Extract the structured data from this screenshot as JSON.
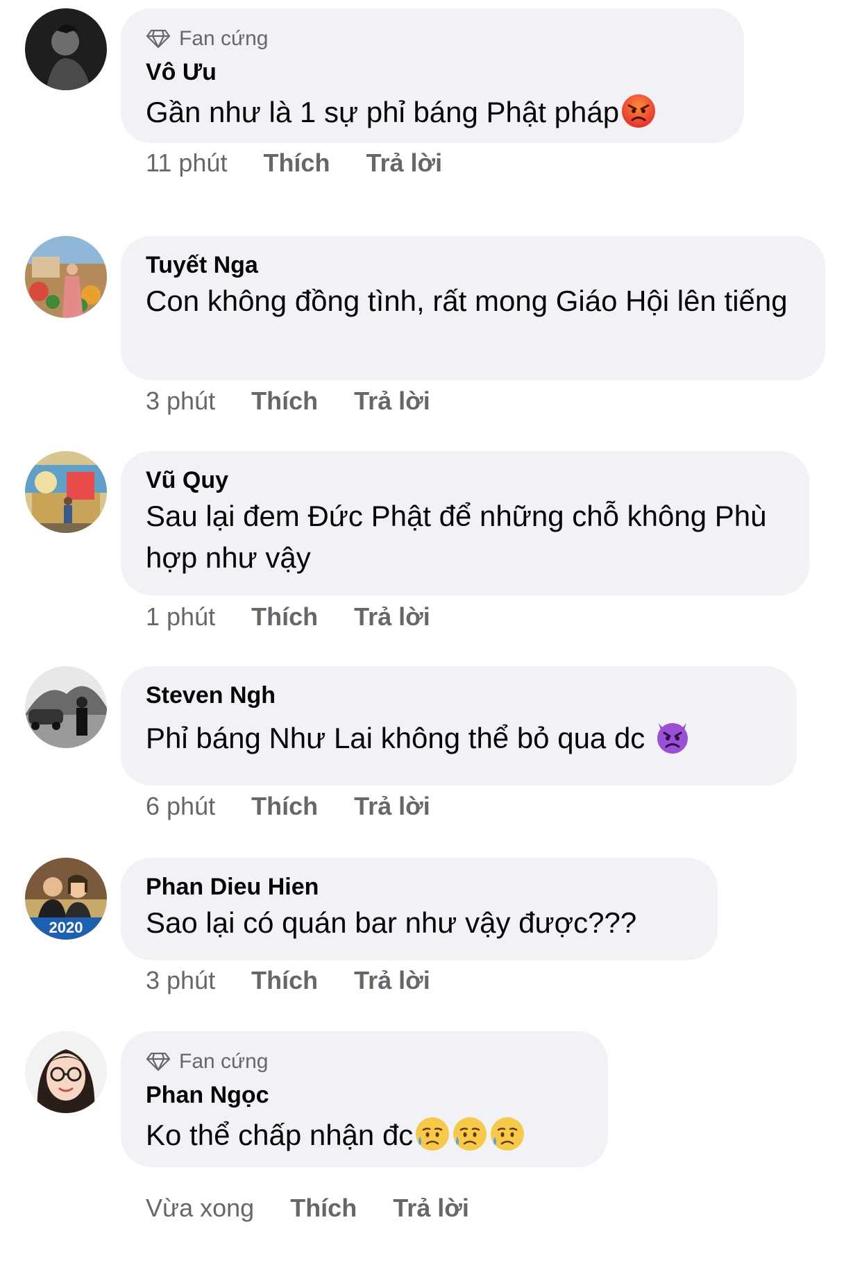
{
  "comments": [
    {
      "badge": "Fan cứng",
      "name": "Vô Ưu",
      "text": "Gần như là 1 sự phỉ báng Phật pháp",
      "emojis": [
        "angry-face"
      ],
      "time": "11 phút",
      "like": "Thích",
      "reply": "Trả lời"
    },
    {
      "name": "Tuyết Nga",
      "text": "Con không đồng tình, rất mong Giáo Hội lên tiếng",
      "time": "3 phút",
      "like": "Thích",
      "reply": "Trả lời"
    },
    {
      "name": "Vũ Quy",
      "text": "Sau lại đem Đức Phật để những chỗ không Phù hợp như vậy",
      "time": "1 phút",
      "like": "Thích",
      "reply": "Trả lời"
    },
    {
      "name": "Steven Ngh",
      "text": "Phỉ báng Như Lai không thể bỏ qua dc ",
      "emojis": [
        "angry-devil-face"
      ],
      "time": "6 phút",
      "like": "Thích",
      "reply": "Trả lời"
    },
    {
      "name": "Phan Dieu Hien",
      "text": "Sao lại có quán bar như vậy được???",
      "time": "3 phút",
      "like": "Thích",
      "reply": "Trả lời"
    },
    {
      "badge": "Fan cứng",
      "name": "Phan Ngọc",
      "text": "Ko thể chấp nhận đc",
      "emojis": [
        "sad-sweat-face",
        "sad-sweat-face",
        "sad-sweat-face"
      ],
      "time": "Vừa xong",
      "like": "Thích",
      "reply": "Trả lời"
    }
  ],
  "avatar_texts": {
    "new_year": "2020"
  },
  "colors": {
    "bubble": "#f0f2f5",
    "meta": "#65676b",
    "name": "#050505"
  }
}
